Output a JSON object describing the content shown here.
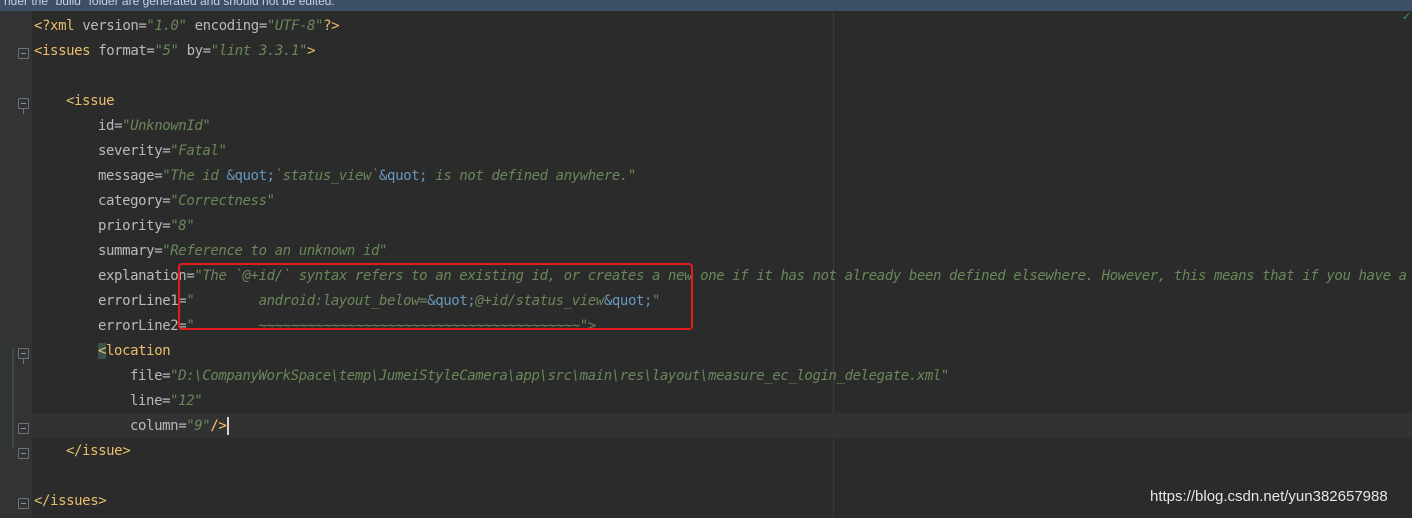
{
  "banner": {
    "text": "nder the \"build\" folder are generated and should not be edited."
  },
  "code": {
    "xml_decl": {
      "open": "<?xml ",
      "version_attr": "version",
      "version_val": "\"1.0\"",
      "encoding_attr": "encoding",
      "encoding_val": "\"UTF-8\"",
      "close": "?>"
    },
    "issues_open": {
      "tag": "<issues",
      "format_attr": "format",
      "format_val": "\"5\"",
      "by_attr": "by",
      "by_val": "\"lint 3.3.1\"",
      "close": ">"
    },
    "issue_open": "<issue",
    "id_attr": "id",
    "id_val": "\"UnknownId\"",
    "severity_attr": "severity",
    "severity_val": "\"Fatal\"",
    "message_attr": "message",
    "message_val_1": "\"The id ",
    "message_ent_1": "&quot;",
    "message_val_2": "`status_view`",
    "message_ent_2": "&quot;",
    "message_val_3": " is not defined anywhere.\"",
    "category_attr": "category",
    "category_val": "\"Correctness\"",
    "priority_attr": "priority",
    "priority_val": "\"8\"",
    "summary_attr": "summary",
    "summary_val": "\"Reference to an unknown id\"",
    "explanation_attr": "explanation",
    "explanation_val": "\"The `@+id/` syntax refers to an existing id, or creates a new one if it has not already been defined elsewhere. However, this means that if you have a typo",
    "errorLine1_attr": "errorLine1",
    "errorLine1_val_1": "\"        android:layout_below=",
    "errorLine1_ent_1": "&quot;",
    "errorLine1_val_2": "@+id/status_view",
    "errorLine1_ent_2": "&quot;",
    "errorLine1_val_3": "\"",
    "errorLine2_attr": "errorLine2",
    "errorLine2_val_1": "\"        ",
    "errorLine2_squiggle": "~~~~~~~~~~~~~~~~~~~~~~~~~~~~~~~~~~~~~~~~",
    "errorLine2_val_2": "\">",
    "location_lt": "<",
    "location_tag": "location",
    "file_attr": "file",
    "file_val": "\"D:\\CompanyWorkSpace\\temp\\JumeiStyleCamera\\app\\src\\main\\res\\layout\\measure_ec_login_delegate.xml\"",
    "line_attr": "line",
    "line_val": "\"12\"",
    "column_attr": "column",
    "column_val": "\"9\"",
    "self_close": "/>",
    "issue_close": "</issue>",
    "issues_close": "</issues>"
  },
  "watermark": "https://blog.csdn.net/yun382657988",
  "colors": {
    "background": "#2b2b2b",
    "gutter": "#313335",
    "tag": "#e8bf6a",
    "attribute": "#bababa",
    "string": "#6a8759",
    "entity": "#6897bb",
    "highlight_box": "#e11d1d"
  }
}
